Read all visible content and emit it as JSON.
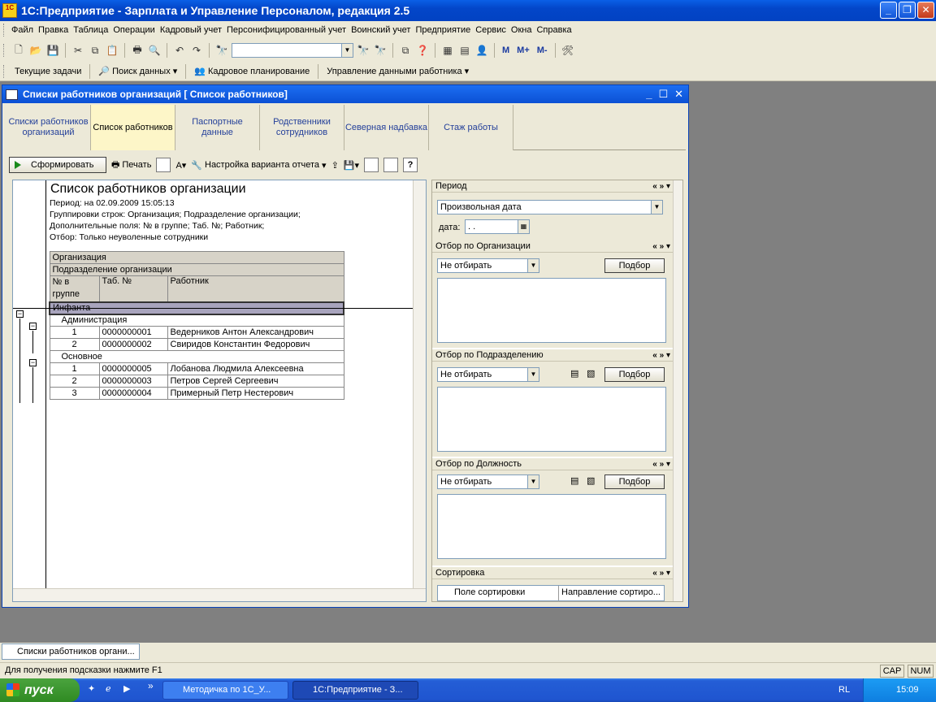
{
  "app": {
    "title": "1С:Предприятие - Зарплата и Управление Персоналом, редакция 2.5",
    "logo_text": "1C"
  },
  "menubar": [
    "Файл",
    "Правка",
    "Таблица",
    "Операции",
    "Кадровый учет",
    "Персонифицированный учет",
    "Воинский учет",
    "Предприятие",
    "Сервис",
    "Окна",
    "Справка"
  ],
  "toolbar1": {
    "mbuttons": [
      "М",
      "М+",
      "М-"
    ]
  },
  "toolbar2": {
    "items": [
      "Текущие задачи",
      "Поиск данных",
      "Кадровое планирование",
      "Управление данными работника"
    ]
  },
  "child_window": {
    "title": "Списки работников организаций [ Список работников]",
    "tabs": [
      {
        "label": "Списки работников организаций",
        "active": false
      },
      {
        "label": "Список работников",
        "active": true
      },
      {
        "label": "Паспортные данные",
        "active": false
      },
      {
        "label": "Родственники сотрудников",
        "active": false
      },
      {
        "label": "Северная надбавка",
        "active": false
      },
      {
        "label": "Стаж работы",
        "active": false
      }
    ],
    "toolbar": {
      "generate": "Сформировать",
      "print": "Печать",
      "settings": "Настройка варианта отчета",
      "help": "?"
    }
  },
  "report": {
    "title": "Список работников организации",
    "period": "Период: на 02.09.2009 15:05:13",
    "groupings": "Группировки строк: Организация; Подразделение организации;",
    "extra_fields": "Дополнительные поля: № в группе; Таб. №; Работник;",
    "filter": "Отбор: Только неуволенные сотрудники",
    "headers": {
      "org": "Организация",
      "dept": "Подразделение организации",
      "num": "№ в группе",
      "tab": "Таб. №",
      "worker": "Работник"
    },
    "org_name": "Инфанта",
    "groups": [
      {
        "name": "Администрация",
        "rows": [
          {
            "n": "1",
            "tab": "0000000001",
            "name": "Ведерников Антон Александрович"
          },
          {
            "n": "2",
            "tab": "0000000002",
            "name": "Свиридов Константин Федорович"
          }
        ]
      },
      {
        "name": "Основное",
        "rows": [
          {
            "n": "1",
            "tab": "0000000005",
            "name": "Лобанова Людмила Алексеевна"
          },
          {
            "n": "2",
            "tab": "0000000003",
            "name": "Петров Сергей Сергеевич"
          },
          {
            "n": "3",
            "tab": "0000000004",
            "name": "Примерный Петр Нестерович"
          }
        ]
      }
    ]
  },
  "panel": {
    "controls": "« » ▾",
    "period": {
      "title": "Период",
      "value": "Произвольная дата",
      "date_label": "дата:",
      "date_value": " .  .  "
    },
    "org": {
      "title": "Отбор по Организации",
      "value": "Не отбирать",
      "button": "Подбор"
    },
    "dept": {
      "title": "Отбор по Подразделению",
      "value": "Не отбирать",
      "button": "Подбор"
    },
    "pos": {
      "title": "Отбор по Должность",
      "value": "Не отбирать",
      "button": "Подбор"
    },
    "sort": {
      "title": "Сортировка",
      "col1": "Поле сортировки",
      "col2": "Направление сортиро..."
    }
  },
  "winlist": {
    "tab": "Списки работников органи..."
  },
  "status": {
    "hint": "Для получения подсказки нажмите F1",
    "cap": "CAP",
    "num": "NUM"
  },
  "taskbar": {
    "start": "пуск",
    "more": "»",
    "tasks": [
      "Методичка по 1С_У...",
      "1С:Предприятие - З..."
    ],
    "lang": "RL",
    "time": "15:09"
  }
}
